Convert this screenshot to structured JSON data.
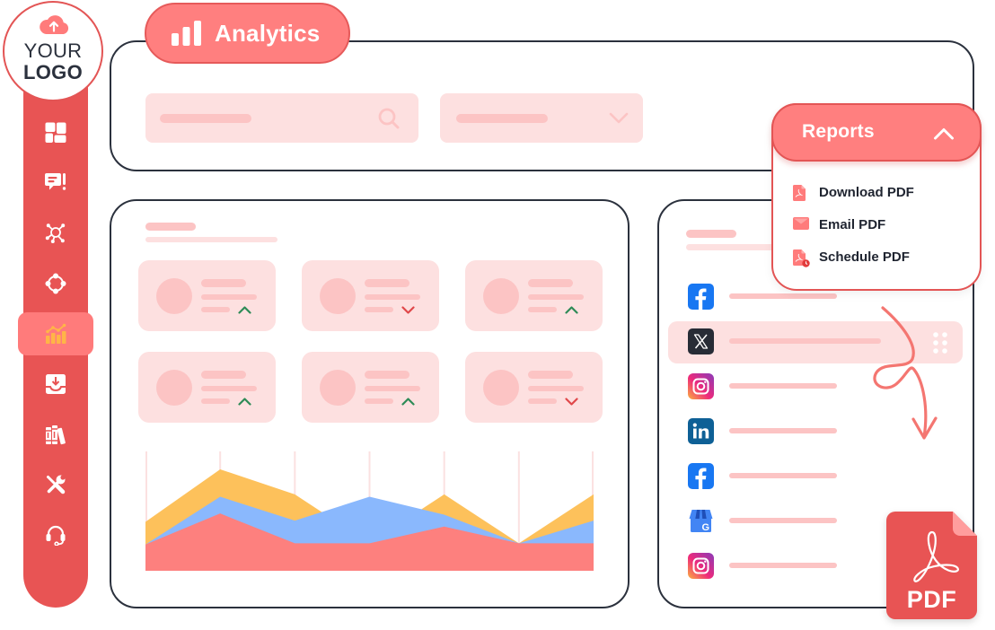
{
  "logo": {
    "line1": "YOUR",
    "line2": "LOGO",
    "icon": "cloud-upload-icon"
  },
  "sidebar": {
    "items": [
      {
        "icon": "dashboard-icon",
        "active": false
      },
      {
        "icon": "feedback-icon",
        "active": false
      },
      {
        "icon": "network-icon",
        "active": false
      },
      {
        "icon": "integrations-icon",
        "active": false
      },
      {
        "icon": "analytics-icon",
        "active": true
      },
      {
        "icon": "inbox-download-icon",
        "active": false
      },
      {
        "icon": "library-icon",
        "active": false
      },
      {
        "icon": "tools-icon",
        "active": false
      },
      {
        "icon": "support-headset-icon",
        "active": false
      }
    ]
  },
  "header": {
    "title": "Analytics",
    "icon": "bar-chart-icon"
  },
  "filters": {
    "search": {
      "icon": "search-icon",
      "value_is_skeleton": true
    },
    "dropdown": {
      "icon": "chevron-down-icon",
      "value_is_skeleton": true
    }
  },
  "reports": {
    "title": "Reports",
    "expanded": true,
    "toggle_icon": "chevron-up-icon",
    "items": [
      {
        "label": "Download PDF",
        "icon": "pdf-file-icon"
      },
      {
        "label": "Email PDF",
        "icon": "email-icon"
      },
      {
        "label": "Schedule PDF",
        "icon": "pdf-schedule-icon"
      }
    ]
  },
  "stats_panel": {
    "cards": [
      {
        "trend": "up"
      },
      {
        "trend": "down"
      },
      {
        "trend": "up"
      },
      {
        "trend": "up"
      },
      {
        "trend": "up"
      },
      {
        "trend": "down"
      }
    ]
  },
  "social_panel": {
    "items": [
      {
        "network": "facebook",
        "icon": "facebook-icon",
        "highlighted": false
      },
      {
        "network": "x",
        "icon": "x-icon",
        "highlighted": true
      },
      {
        "network": "instagram",
        "icon": "instagram-icon",
        "highlighted": false
      },
      {
        "network": "linkedin",
        "icon": "linkedin-icon",
        "highlighted": false
      },
      {
        "network": "facebook",
        "icon": "facebook-icon",
        "highlighted": false
      },
      {
        "network": "google-business-profile",
        "icon": "google-business-icon",
        "highlighted": false
      },
      {
        "network": "instagram",
        "icon": "instagram-icon",
        "highlighted": false
      }
    ]
  },
  "export_badge": {
    "label": "PDF",
    "icon": "adobe-acrobat-icon"
  },
  "colors": {
    "brand": "#e85454",
    "accent": "#ff7f7f",
    "skeleton": "#fde0e0",
    "skeleton_strong": "#fcc4c4",
    "outline": "#2b313d",
    "trend_up": "#2e8b57",
    "trend_down": "#e0484a",
    "active_icon": "#ffb547",
    "arrow": "#f47671"
  },
  "chart_data": {
    "type": "area",
    "title": "",
    "xlabel": "",
    "ylabel": "",
    "x": [
      1,
      2,
      3,
      4,
      5,
      6,
      7
    ],
    "x_tick_labels": [],
    "ylim": [
      0,
      100
    ],
    "grid": "vertical",
    "legend": "none",
    "stacked": false,
    "series": [
      {
        "name": "orange",
        "color": "#fdc15b",
        "values": [
          41,
          85,
          64,
          23,
          64,
          23,
          64
        ]
      },
      {
        "name": "blue",
        "color": "#8ab8fd",
        "values": [
          22,
          62,
          42,
          62,
          47,
          23,
          42
        ]
      },
      {
        "name": "red",
        "color": "#fd807e",
        "values": [
          22,
          48,
          23,
          23,
          37,
          23,
          23
        ]
      }
    ]
  }
}
